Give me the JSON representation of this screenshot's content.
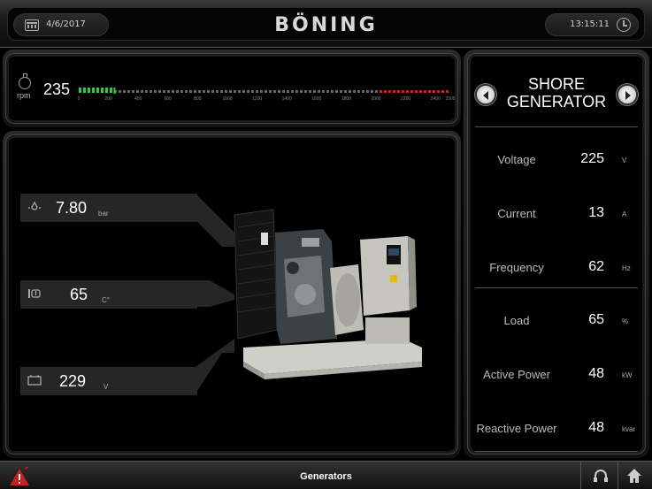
{
  "header": {
    "date": "4/6/2017",
    "logo": "BÖNING",
    "time": "13:15:11"
  },
  "rpm": {
    "unit": "rpm",
    "value": "235",
    "max": 2500,
    "current": 235,
    "ticks": [
      "0",
      "200",
      "400",
      "600",
      "800",
      "1000",
      "1200",
      "1400",
      "1600",
      "1800",
      "2000",
      "2200",
      "2400",
      "2500"
    ],
    "colors": {
      "active": "#2ecc40",
      "normal": "#666666",
      "warning": "#d62020"
    }
  },
  "readouts": [
    {
      "icon": "oil-pressure-icon",
      "value": "7.80",
      "unit": "bar"
    },
    {
      "icon": "coolant-temperature-icon",
      "value": "65",
      "unit": "C°"
    },
    {
      "icon": "battery-icon",
      "value": "229",
      "unit": "V"
    }
  ],
  "side": {
    "title_line1": "SHORE",
    "title_line2": "GENERATOR",
    "metrics": [
      {
        "label": "Voltage",
        "value": "225",
        "unit": "V"
      },
      {
        "label": "Current",
        "value": "13",
        "unit": "A"
      },
      {
        "label": "Frequency",
        "value": "62",
        "unit": "Hz"
      },
      {
        "label": "Load",
        "value": "65",
        "unit": "%"
      },
      {
        "label": "Active Power",
        "value": "48",
        "unit": "kW"
      },
      {
        "label": "Reactive Power",
        "value": "48",
        "unit": "kvar"
      }
    ]
  },
  "footer": {
    "title": "Generators",
    "icons": [
      "alarm-warning-icon",
      "headphones-icon",
      "home-icon"
    ],
    "alarm_color": "#d62020"
  }
}
